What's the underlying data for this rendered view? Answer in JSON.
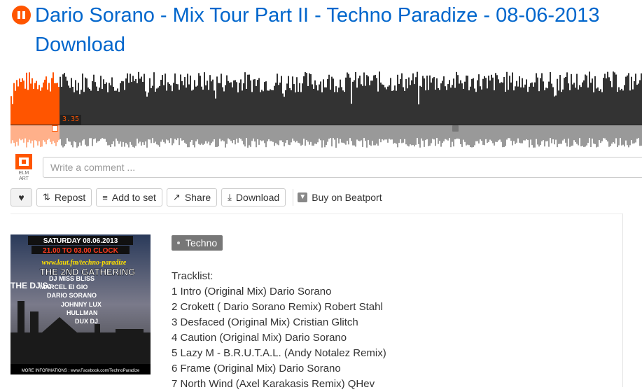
{
  "track": {
    "title_line1": "Dario Sorano - Mix Tour Part II - Techno Paradize - 08-06-2013",
    "title_line2": "Download",
    "current_time": "3.35",
    "progress": 0.078
  },
  "comment": {
    "avatar_label": "ELM ART",
    "placeholder": "Write a comment ..."
  },
  "actions": {
    "repost": "Repost",
    "add_to_set": "Add to set",
    "share": "Share",
    "download": "Download",
    "buy": "Buy on Beatport"
  },
  "artwork": {
    "date_line": "SATURDAY 08.06.2013",
    "time_line": "21.00 TO 03.00 CLOCK",
    "url_line": "www.laut.fm/techno-paradize",
    "event": "THE 2ND GATHERING",
    "djs_label": "THE DJ'S:",
    "djs": [
      "DJ MISS BLISS",
      "MARCEL EI GIO",
      "DARIO SORANO",
      "JOHNNY LUX",
      "HULLMAN",
      "DUX DJ"
    ],
    "footer": "MORE INFORMATIONS : www.Facebook.com/TechnoParadize"
  },
  "tag": "Techno",
  "tracklist": {
    "heading": "Tracklist:",
    "items": [
      "1 Intro (Original Mix) Dario Sorano",
      "2 Crokett ( Dario Sorano Remix) Robert Stahl",
      "3 Desfaced (Original Mix) Cristian Glitch",
      "4 Caution (Original Mix) Dario Sorano",
      "5 Lazy M - B.R.U.T.A.L. (Andy Notalez Remix)",
      "6 Frame (Original Mix) Dario Sorano",
      "7 North Wind (Axel Karakasis Remix) QHev"
    ]
  },
  "colors": {
    "accent": "#ff5500",
    "link": "#0066cc",
    "waveform_dark": "#333333",
    "waveform_light": "#999999"
  }
}
